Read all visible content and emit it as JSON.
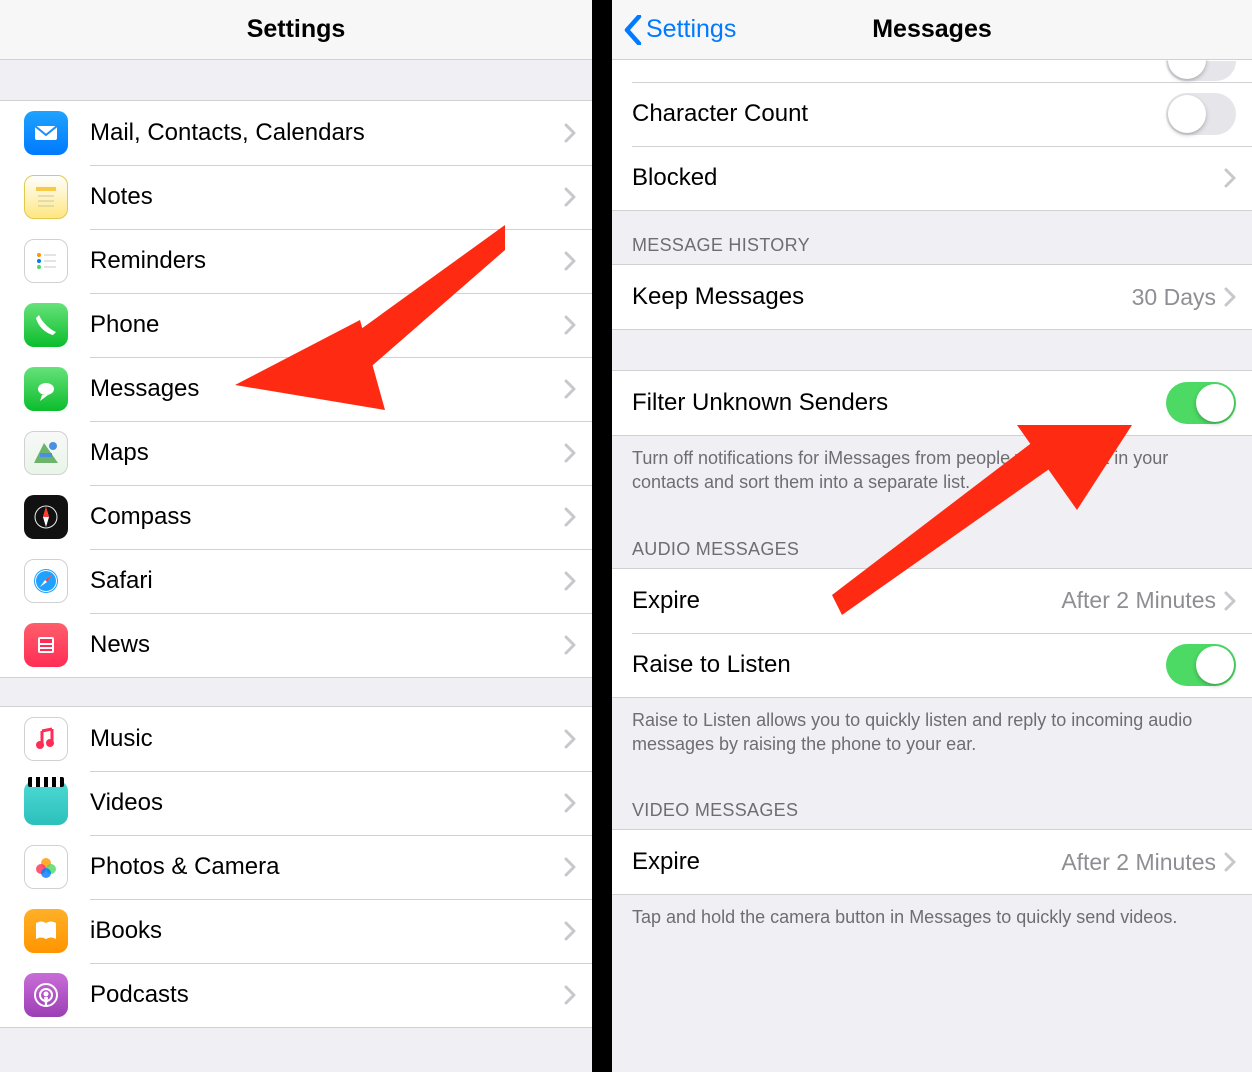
{
  "left": {
    "title": "Settings",
    "group1": [
      {
        "label": "Mail, Contacts, Calendars",
        "icon": "mail",
        "name": "settings-item-mail"
      },
      {
        "label": "Notes",
        "icon": "notes",
        "name": "settings-item-notes"
      },
      {
        "label": "Reminders",
        "icon": "reminders",
        "name": "settings-item-reminders"
      },
      {
        "label": "Phone",
        "icon": "phone",
        "name": "settings-item-phone"
      },
      {
        "label": "Messages",
        "icon": "messages",
        "name": "settings-item-messages"
      },
      {
        "label": "Maps",
        "icon": "maps",
        "name": "settings-item-maps"
      },
      {
        "label": "Compass",
        "icon": "compass",
        "name": "settings-item-compass"
      },
      {
        "label": "Safari",
        "icon": "safari",
        "name": "settings-item-safari"
      },
      {
        "label": "News",
        "icon": "news",
        "name": "settings-item-news"
      }
    ],
    "group2": [
      {
        "label": "Music",
        "icon": "music",
        "name": "settings-item-music"
      },
      {
        "label": "Videos",
        "icon": "videos",
        "name": "settings-item-videos"
      },
      {
        "label": "Photos & Camera",
        "icon": "photos",
        "name": "settings-item-photos"
      },
      {
        "label": "iBooks",
        "icon": "ibooks",
        "name": "settings-item-ibooks"
      },
      {
        "label": "Podcasts",
        "icon": "podcasts",
        "name": "settings-item-podcasts"
      }
    ]
  },
  "right": {
    "back_label": "Settings",
    "title": "Messages",
    "topRows": {
      "character_count": {
        "label": "Character Count",
        "on": false
      },
      "blocked": {
        "label": "Blocked"
      }
    },
    "history": {
      "header": "MESSAGE HISTORY",
      "keep": {
        "label": "Keep Messages",
        "value": "30 Days"
      }
    },
    "filter": {
      "label": "Filter Unknown Senders",
      "on": true,
      "footer": "Turn off notifications for iMessages from people who are not in your contacts and sort them into a separate list."
    },
    "audio": {
      "header": "AUDIO MESSAGES",
      "expire": {
        "label": "Expire",
        "value": "After 2 Minutes"
      },
      "raise": {
        "label": "Raise to Listen",
        "on": true
      },
      "footer": "Raise to Listen allows you to quickly listen and reply to incoming audio messages by raising the phone to your ear."
    },
    "video": {
      "header": "VIDEO MESSAGES",
      "expire": {
        "label": "Expire",
        "value": "After 2 Minutes"
      },
      "footer": "Tap and hold the camera button in Messages to quickly send videos."
    }
  }
}
